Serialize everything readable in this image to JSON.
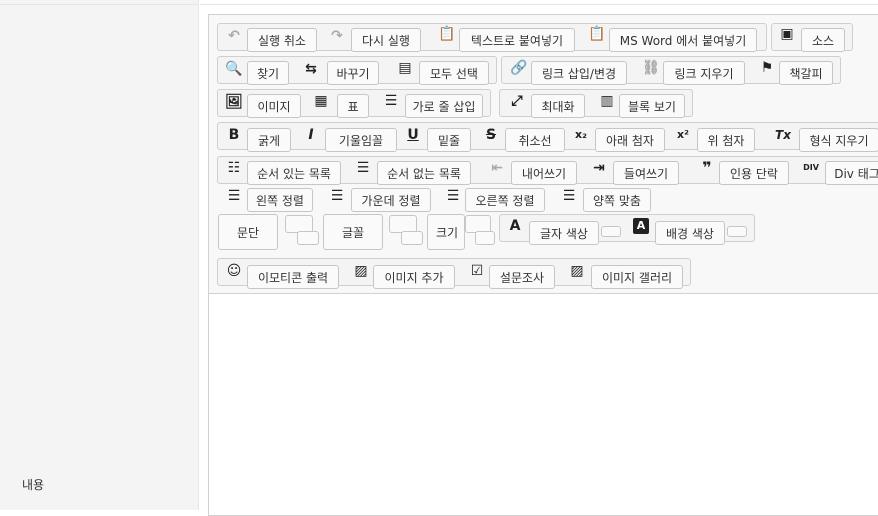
{
  "sidebar": {
    "label": "내용"
  },
  "toolbar": {
    "row1": [
      {
        "label": "실행 취소",
        "icon": "undo-icon"
      },
      {
        "label": "다시 실행",
        "icon": "redo-icon"
      },
      {
        "label": "텍스트로 붙여넣기",
        "icon": "paste-text-icon"
      },
      {
        "label": "MS Word 에서 붙여넣기",
        "icon": "paste-word-icon"
      },
      {
        "label": "소스",
        "icon": "source-icon"
      }
    ],
    "row2": [
      {
        "label": "찾기",
        "icon": "search-icon"
      },
      {
        "label": "바꾸기",
        "icon": "replace-icon"
      },
      {
        "label": "모두 선택",
        "icon": "select-all-icon"
      },
      {
        "label": "링크 삽입/변경",
        "icon": "link-icon"
      },
      {
        "label": "링크 지우기",
        "icon": "unlink-icon"
      },
      {
        "label": "책갈피",
        "icon": "anchor-icon"
      }
    ],
    "row3": [
      {
        "label": "이미지",
        "icon": "image-icon"
      },
      {
        "label": "표",
        "icon": "table-icon"
      },
      {
        "label": "가로 줄 삽입",
        "icon": "horizontal-rule-icon"
      },
      {
        "label": "최대화",
        "icon": "maximize-icon"
      },
      {
        "label": "블록 보기",
        "icon": "show-blocks-icon"
      }
    ],
    "row4": [
      {
        "label": "굵게",
        "icon": "bold-icon",
        "glyph": "B"
      },
      {
        "label": "기울임꼴",
        "icon": "italic-icon",
        "glyph": "I"
      },
      {
        "label": "밑줄",
        "icon": "underline-icon",
        "glyph": "U"
      },
      {
        "label": "취소선",
        "icon": "strikethrough-icon",
        "glyph": "S"
      },
      {
        "label": "아래 첨자",
        "icon": "subscript-icon",
        "glyph": "x₂"
      },
      {
        "label": "위 첨자",
        "icon": "superscript-icon",
        "glyph": "x²"
      },
      {
        "label": "형식 지우기",
        "icon": "remove-format-icon",
        "glyph": "Tx"
      }
    ],
    "row5": [
      {
        "label": "순서 있는 목록",
        "icon": "numbered-list-icon"
      },
      {
        "label": "순서 없는 목록",
        "icon": "bulleted-list-icon"
      },
      {
        "label": "내어쓰기",
        "icon": "outdent-icon"
      },
      {
        "label": "들여쓰기",
        "icon": "indent-icon"
      },
      {
        "label": "인용 단락",
        "icon": "blockquote-icon",
        "glyph": "❞"
      },
      {
        "label": "Div 태그",
        "icon": "div-icon",
        "glyph": "DIV"
      }
    ],
    "row6": [
      {
        "label": "왼쪽 정렬",
        "icon": "align-left-icon"
      },
      {
        "label": "가운데 정렬",
        "icon": "align-center-icon"
      },
      {
        "label": "오른쪽 정렬",
        "icon": "align-right-icon"
      },
      {
        "label": "양쪽 맞춤",
        "icon": "align-justify-icon"
      }
    ],
    "row7": {
      "paragraph": "문단",
      "font": "글꼴",
      "size": "크기",
      "text_color": "글자 색상",
      "bg_color": "배경 색상"
    },
    "row8": [
      {
        "label": "이모티콘 출력",
        "icon": "emoticon-icon"
      },
      {
        "label": "이미지 추가",
        "icon": "add-image-icon"
      },
      {
        "label": "설문조사",
        "icon": "survey-icon"
      },
      {
        "label": "이미지 갤러리",
        "icon": "gallery-icon"
      }
    ]
  }
}
